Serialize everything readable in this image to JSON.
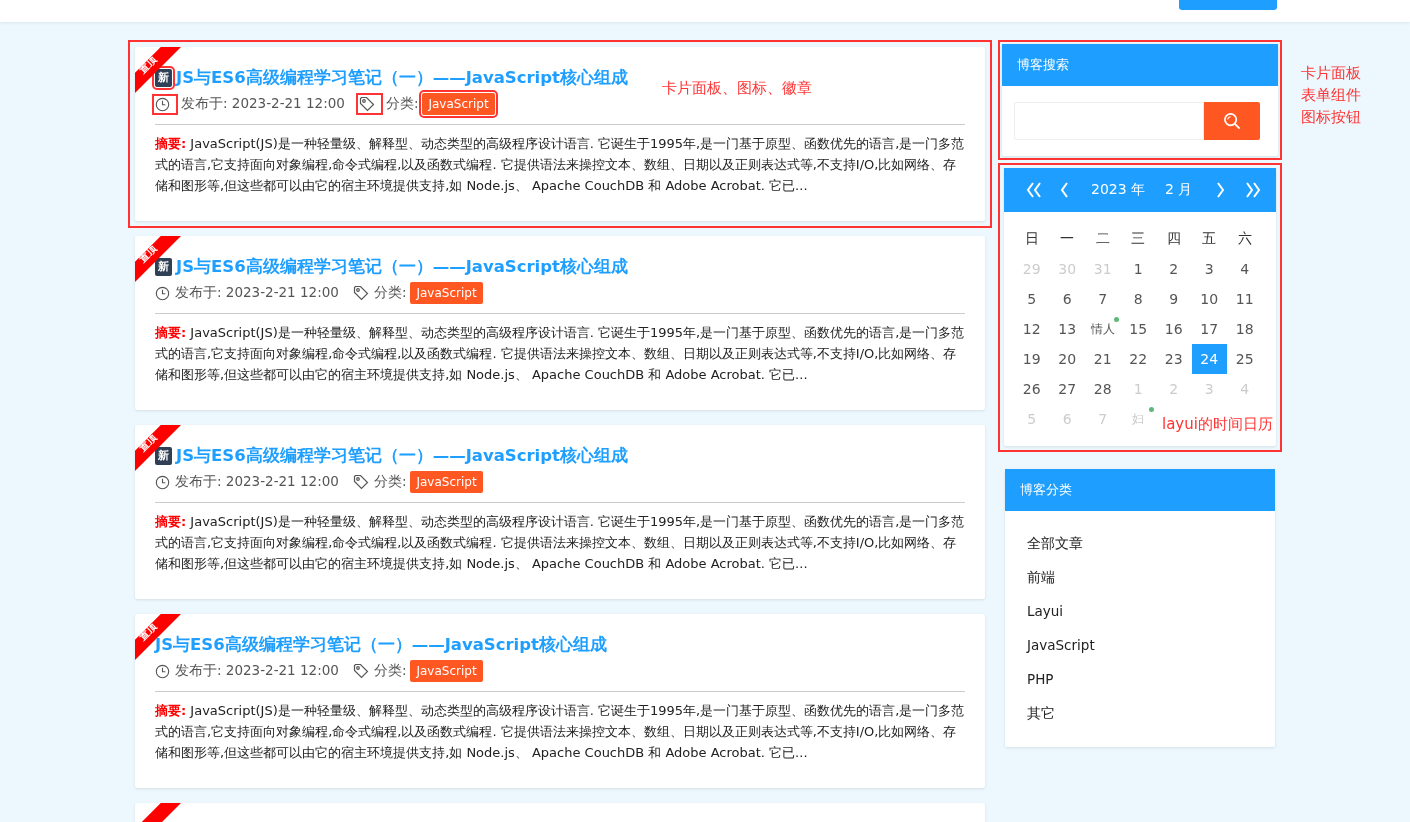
{
  "posts": [
    {
      "ribbon": "置顶",
      "badge": "新",
      "title": "JS与ES6高级编程学习笔记（一）——JavaScript核心组成",
      "date": "发布于: 2023-2-21 12:00",
      "category_label": "分类:",
      "category": "JavaScript",
      "summary_label": "摘要:",
      "summary": "JavaScript(JS)是一种轻量级、解释型、动态类型的高级程序设计语言. 它诞生于1995年,是一门基于原型、函数优先的语言,是一门多范式的语言,它支持面向对象编程,命令式编程,以及函数式编程. 它提供语法来操控文本、数组、日期以及正则表达式等,不支持I/O,比如网络、存储和图形等,但这些都可以由它的宿主环境提供支持,如 Node.js、 Apache CouchDB 和 Adobe Acrobat. 它已...",
      "highlighted": true,
      "note": "卡片面板、图标、徽章"
    },
    {
      "ribbon": "置顶",
      "badge": "新",
      "title": "JS与ES6高级编程学习笔记（一）——JavaScript核心组成",
      "date": "发布于: 2023-2-21 12:00",
      "category_label": "分类:",
      "category": "JavaScript",
      "summary_label": "摘要:",
      "summary": "JavaScript(JS)是一种轻量级、解释型、动态类型的高级程序设计语言. 它诞生于1995年,是一门基于原型、函数优先的语言,是一门多范式的语言,它支持面向对象编程,命令式编程,以及函数式编程. 它提供语法来操控文本、数组、日期以及正则表达式等,不支持I/O,比如网络、存储和图形等,但这些都可以由它的宿主环境提供支持,如 Node.js、 Apache CouchDB 和 Adobe Acrobat. 它已...",
      "highlighted": false
    },
    {
      "ribbon": "置顶",
      "badge": "新",
      "title": "JS与ES6高级编程学习笔记（一）——JavaScript核心组成",
      "date": "发布于: 2023-2-21 12:00",
      "category_label": "分类:",
      "category": "JavaScript",
      "summary_label": "摘要:",
      "summary": "JavaScript(JS)是一种轻量级、解释型、动态类型的高级程序设计语言. 它诞生于1995年,是一门基于原型、函数优先的语言,是一门多范式的语言,它支持面向对象编程,命令式编程,以及函数式编程. 它提供语法来操控文本、数组、日期以及正则表达式等,不支持I/O,比如网络、存储和图形等,但这些都可以由它的宿主环境提供支持,如 Node.js、 Apache CouchDB 和 Adobe Acrobat. 它已...",
      "highlighted": false
    },
    {
      "ribbon": "置顶",
      "title": "JS与ES6高级编程学习笔记（一）——JavaScript核心组成",
      "date": "发布于: 2023-2-21 12:00",
      "category_label": "分类:",
      "category": "JavaScript",
      "summary_label": "摘要:",
      "summary": "JavaScript(JS)是一种轻量级、解释型、动态类型的高级程序设计语言. 它诞生于1995年,是一门基于原型、函数优先的语言,是一门多范式的语言,它支持面向对象编程,命令式编程,以及函数式编程. 它提供语法来操控文本、数组、日期以及正则表达式等,不支持I/O,比如网络、存储和图形等,但这些都可以由它的宿主环境提供支持,如 Node.js、 Apache CouchDB 和 Adobe Acrobat. 它已...",
      "highlighted": false
    },
    {
      "pinned": true
    }
  ],
  "search_panel": {
    "title": "博客搜索",
    "highlighted": true,
    "notes": [
      "卡片面板",
      "表单组件",
      "图标按钮"
    ]
  },
  "calendar": {
    "year": "2023 年",
    "month": "2 月",
    "highlighted": true,
    "note": "layui的时间日历",
    "weekdays": [
      "日",
      "一",
      "二",
      "三",
      "四",
      "五",
      "六"
    ],
    "weeks": [
      [
        {
          "text": "29",
          "muted": true,
          "selected": false,
          "dot": false
        },
        {
          "text": "30",
          "muted": true,
          "selected": false,
          "dot": false
        },
        {
          "text": "31",
          "muted": true,
          "selected": false,
          "dot": false
        },
        {
          "text": "1",
          "muted": false,
          "selected": false,
          "dot": false
        },
        {
          "text": "2",
          "muted": false,
          "selected": false,
          "dot": false
        },
        {
          "text": "3",
          "muted": false,
          "selected": false,
          "dot": false
        },
        {
          "text": "4",
          "muted": false,
          "selected": false,
          "dot": false
        }
      ],
      [
        {
          "text": "5",
          "muted": false,
          "selected": false,
          "dot": false
        },
        {
          "text": "6",
          "muted": false,
          "selected": false,
          "dot": false
        },
        {
          "text": "7",
          "muted": false,
          "selected": false,
          "dot": false
        },
        {
          "text": "8",
          "muted": false,
          "selected": false,
          "dot": false
        },
        {
          "text": "9",
          "muted": false,
          "selected": false,
          "dot": false
        },
        {
          "text": "10",
          "muted": false,
          "selected": false,
          "dot": false
        },
        {
          "text": "11",
          "muted": false,
          "selected": false,
          "dot": false
        }
      ],
      [
        {
          "text": "12",
          "muted": false,
          "selected": false,
          "dot": false
        },
        {
          "text": "13",
          "muted": false,
          "selected": false,
          "dot": false
        },
        {
          "text": "情人",
          "muted": false,
          "selected": false,
          "dot": true
        },
        {
          "text": "15",
          "muted": false,
          "selected": false,
          "dot": false
        },
        {
          "text": "16",
          "muted": false,
          "selected": false,
          "dot": false
        },
        {
          "text": "17",
          "muted": false,
          "selected": false,
          "dot": false
        },
        {
          "text": "18",
          "muted": false,
          "selected": false,
          "dot": false
        }
      ],
      [
        {
          "text": "19",
          "muted": false,
          "selected": false,
          "dot": false
        },
        {
          "text": "20",
          "muted": false,
          "selected": false,
          "dot": false
        },
        {
          "text": "21",
          "muted": false,
          "selected": false,
          "dot": false
        },
        {
          "text": "22",
          "muted": false,
          "selected": false,
          "dot": false
        },
        {
          "text": "23",
          "muted": false,
          "selected": false,
          "dot": false
        },
        {
          "text": "24",
          "muted": false,
          "selected": true,
          "dot": false
        },
        {
          "text": "25",
          "muted": false,
          "selected": false,
          "dot": false
        }
      ],
      [
        {
          "text": "26",
          "muted": false,
          "selected": false,
          "dot": false
        },
        {
          "text": "27",
          "muted": false,
          "selected": false,
          "dot": false
        },
        {
          "text": "28",
          "muted": false,
          "selected": false,
          "dot": false
        },
        {
          "text": "1",
          "muted": true,
          "selected": false,
          "dot": false
        },
        {
          "text": "2",
          "muted": true,
          "selected": false,
          "dot": false
        },
        {
          "text": "3",
          "muted": true,
          "selected": false,
          "dot": false
        },
        {
          "text": "4",
          "muted": true,
          "selected": false,
          "dot": false
        }
      ],
      [
        {
          "text": "5",
          "muted": true,
          "selected": false,
          "dot": false
        },
        {
          "text": "6",
          "muted": true,
          "selected": false,
          "dot": false
        },
        {
          "text": "7",
          "muted": true,
          "selected": false,
          "dot": false
        },
        {
          "text": "妇",
          "muted": true,
          "selected": false,
          "dot": true
        }
      ]
    ]
  },
  "categories_panel": {
    "title": "博客分类",
    "items": [
      "全部文章",
      "前端",
      "Layui",
      "JavaScript",
      "PHP",
      "其它"
    ]
  }
}
